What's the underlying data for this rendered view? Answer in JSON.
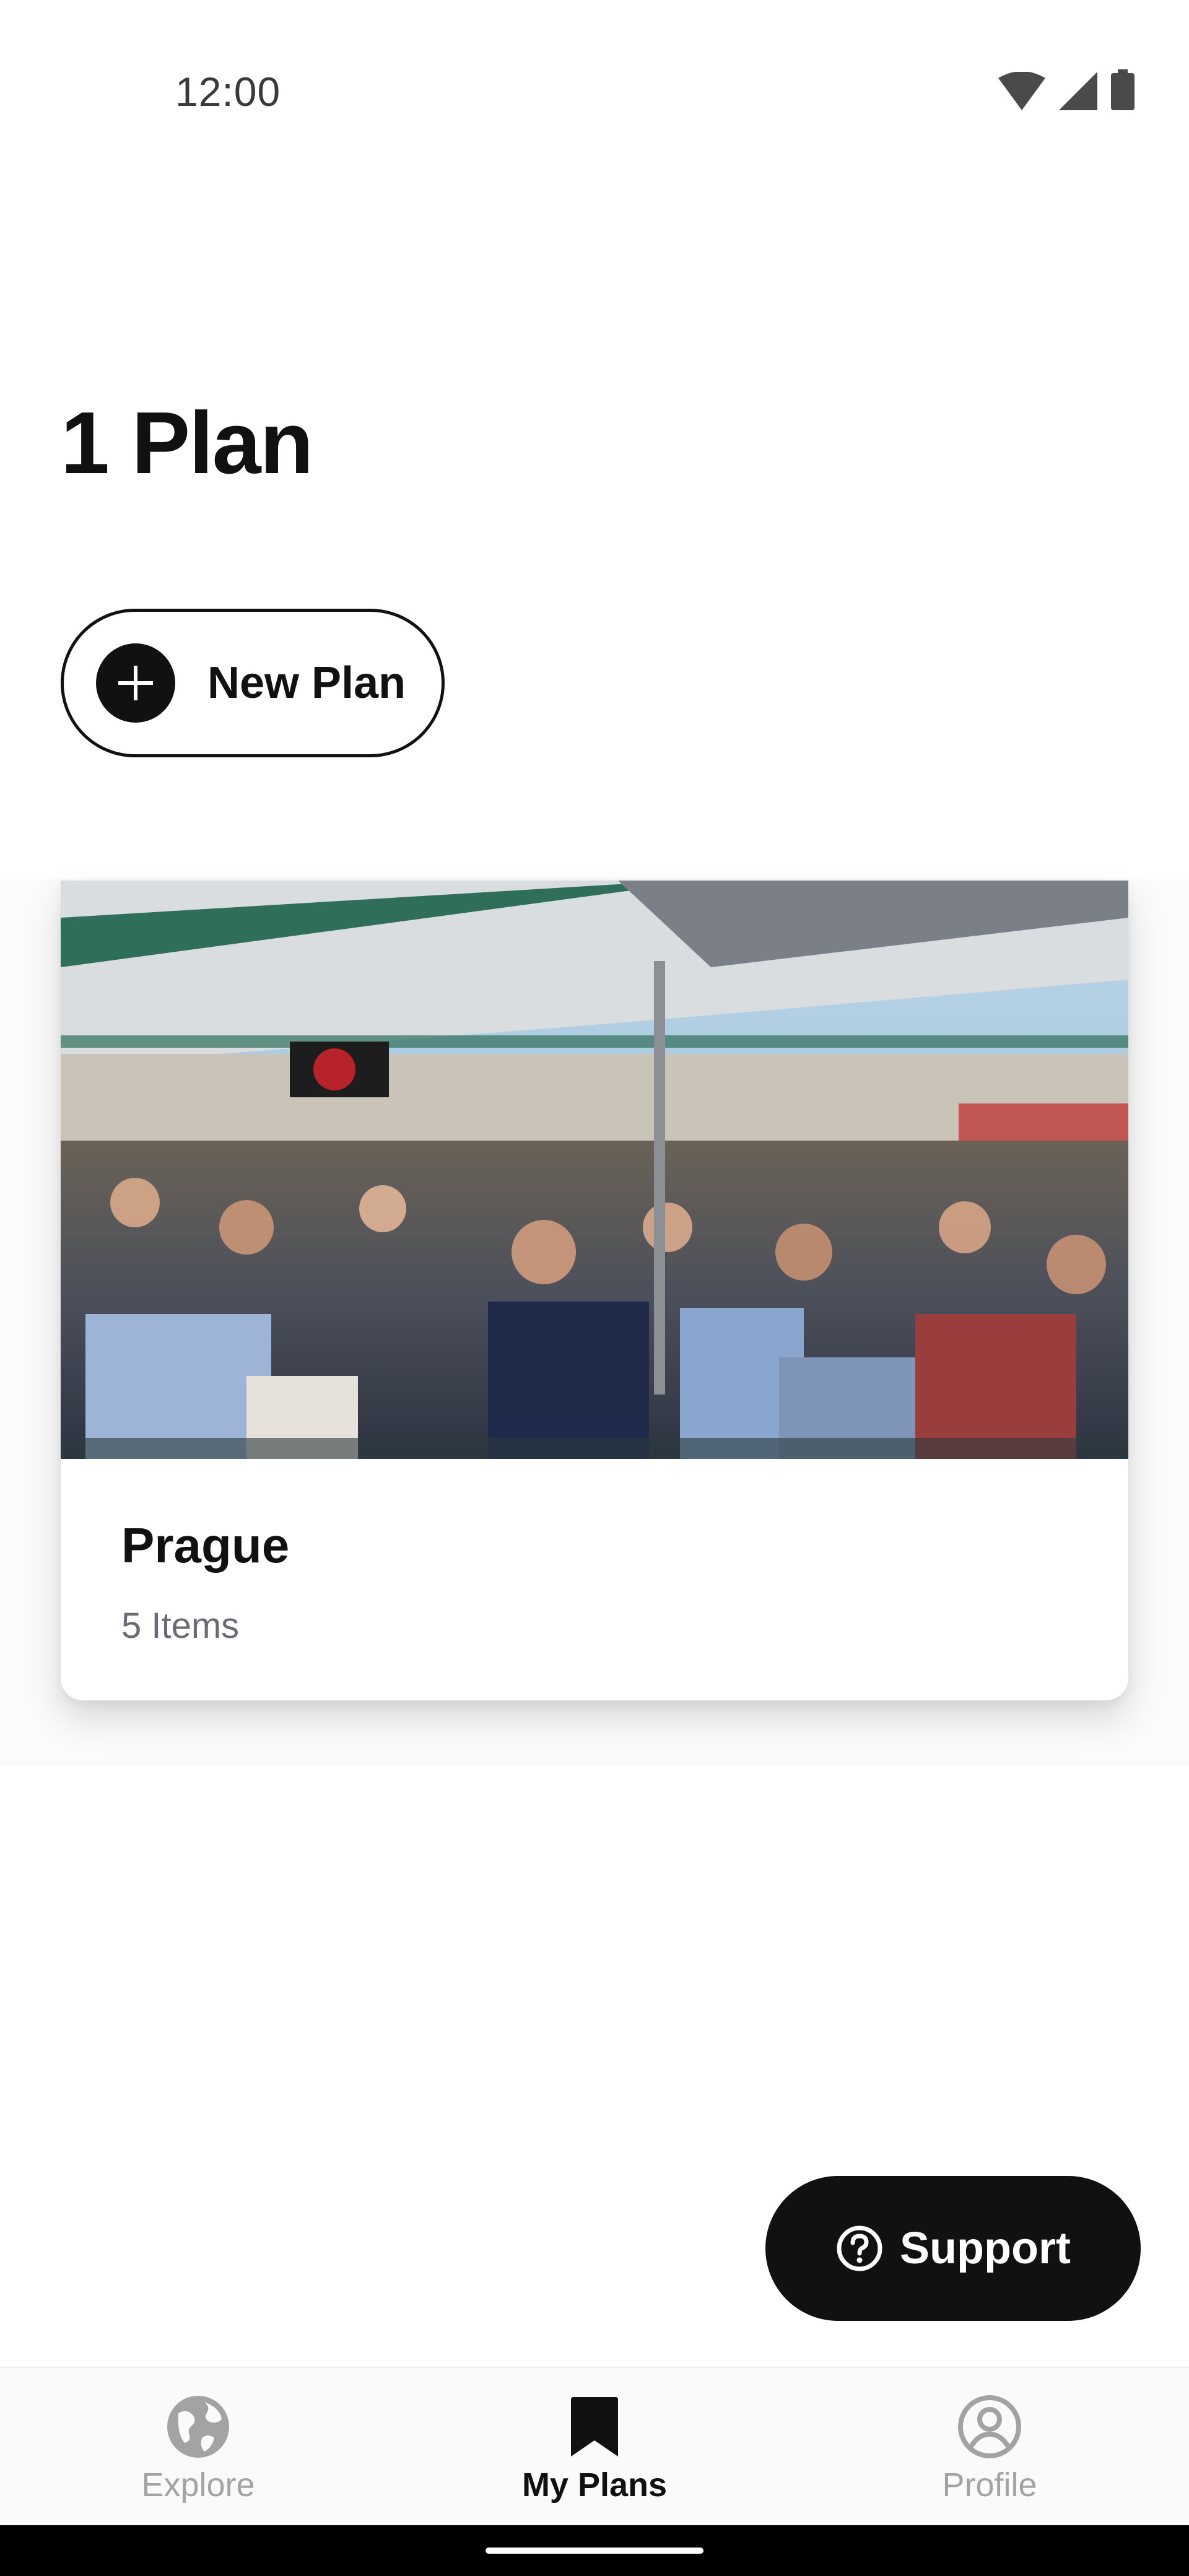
{
  "status_bar": {
    "time": "12:00",
    "icons": [
      "wifi-icon",
      "cellular-signal-icon",
      "battery-icon"
    ]
  },
  "page": {
    "title": "1 Plan"
  },
  "new_plan_button": {
    "label": "New Plan",
    "icon": "plus-icon"
  },
  "plans": [
    {
      "name": "Prague",
      "items_label": "5 Items",
      "image": "outdoor-terrace-restaurant-crowd-photo"
    }
  ],
  "support_button": {
    "label": "Support",
    "icon": "question-circle-icon"
  },
  "bottom_nav": {
    "items": [
      {
        "label": "Explore",
        "icon": "globe-icon",
        "active": false
      },
      {
        "label": "My Plans",
        "icon": "bookmark-icon",
        "active": true
      },
      {
        "label": "Profile",
        "icon": "user-circle-icon",
        "active": false
      }
    ]
  },
  "colors": {
    "primary": "#111111",
    "background": "#ffffff",
    "inactive": "#a3a3a3",
    "muted_text": "#6b6b75"
  }
}
